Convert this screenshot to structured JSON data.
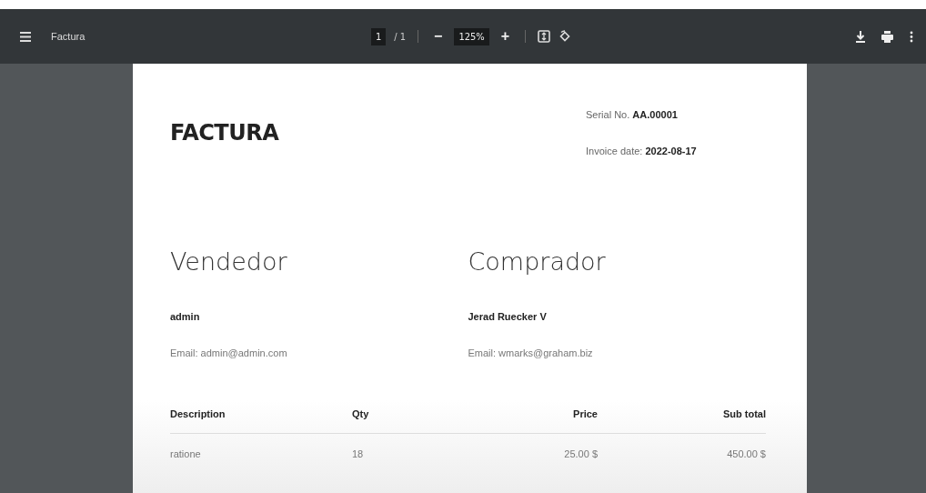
{
  "toolbar": {
    "title": "Factura",
    "page_current": "1",
    "page_total": "/ 1",
    "zoom_out": "−",
    "zoom": "125%",
    "zoom_in": "+"
  },
  "invoice": {
    "title": "FACTURA",
    "serial_label": "Serial No.",
    "serial": "AA.00001",
    "date_label": "Invoice date:",
    "date": "2022-08-17",
    "parties": [
      {
        "heading": "Vendedor",
        "name": "admin",
        "email": "Email: admin@admin.com"
      },
      {
        "heading": "Comprador",
        "name": "Jerad Ruecker V",
        "email": "Email: wmarks@graham.biz"
      }
    ],
    "table": {
      "columns": [
        "Description",
        "Qty",
        "Price",
        "Sub total"
      ],
      "rows": [
        [
          "ratione",
          "18",
          "25.00 $",
          "450.00 $"
        ]
      ]
    }
  }
}
